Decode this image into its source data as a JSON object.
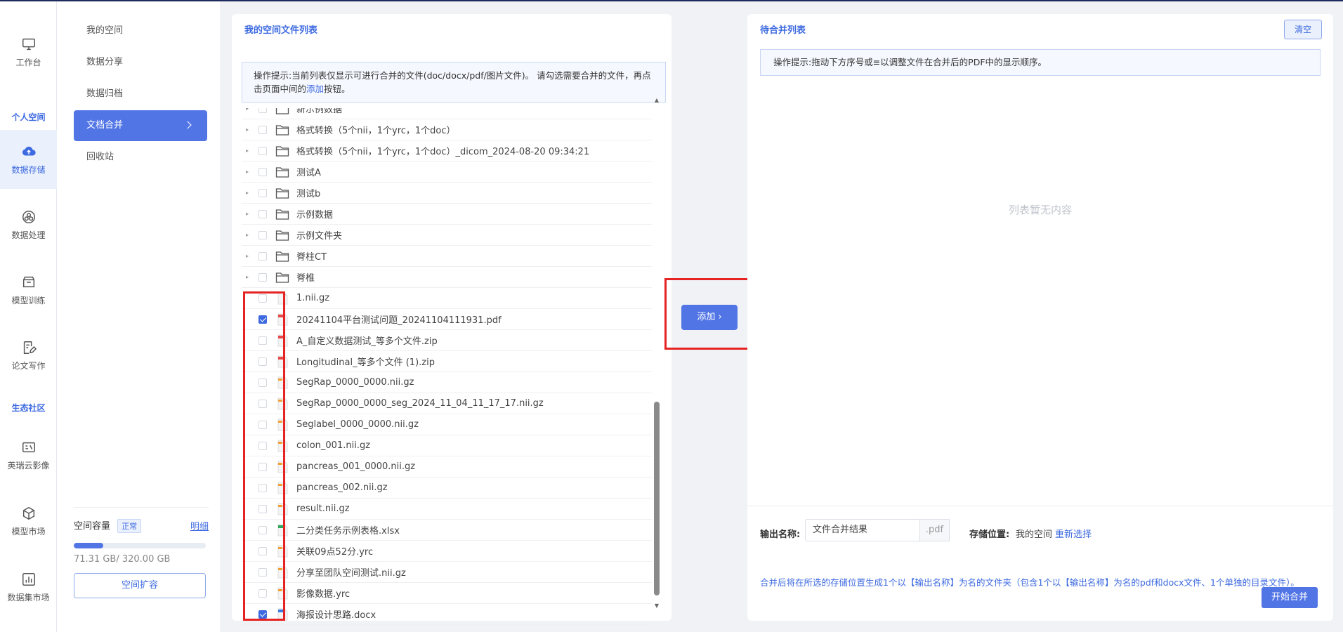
{
  "nav": {
    "items": [
      {
        "label": "工作台",
        "icon": "monitor-icon"
      },
      {
        "label": "数据存储",
        "icon": "cloud-upload-icon"
      },
      {
        "label": "数据处理",
        "icon": "process-icon"
      },
      {
        "label": "模型训练",
        "icon": "box-icon"
      },
      {
        "label": "论文写作",
        "icon": "edit-icon"
      },
      {
        "label": "英瑞云影像",
        "icon": "image-icon"
      },
      {
        "label": "模型市场",
        "icon": "cube-icon"
      },
      {
        "label": "数据集市场",
        "icon": "chart-icon"
      }
    ],
    "section_personal": "个人空间",
    "section_community": "生态社区"
  },
  "submenu": {
    "items": [
      "我的空间",
      "数据分享",
      "数据归档",
      "文档合并",
      "回收站"
    ],
    "active": "文档合并"
  },
  "storage": {
    "title": "空间容量",
    "status": "正常",
    "detail_link": "明细",
    "usage_text": "71.31 GB/ 320.00 GB",
    "used_fraction": 0.223,
    "expand_label": "空间扩容"
  },
  "file_panel": {
    "title": "我的空间文件列表",
    "hint_text": "操作提示:当前列表仅显示可进行合并的文件(doc/docx/pdf/图片文件)。 请勾选需要合并的文件，再点击页面中间的",
    "hint_link": "添加",
    "hint_suffix": "按钮。",
    "rows": [
      {
        "name": "新示例数据",
        "type": "folder",
        "checked": false
      },
      {
        "name": "格式转换（5个nii，1个yrc，1个doc）",
        "type": "folder",
        "checked": false
      },
      {
        "name": "格式转换（5个nii，1个yrc，1个doc）_dicom_2024-08-20 09:34:21",
        "type": "folder",
        "checked": false
      },
      {
        "name": "测试A",
        "type": "folder",
        "checked": false
      },
      {
        "name": "测试b",
        "type": "folder",
        "checked": false
      },
      {
        "name": "示例数据",
        "type": "folder",
        "checked": false
      },
      {
        "name": "示例文件夹",
        "type": "folder",
        "checked": false
      },
      {
        "name": "脊柱CT",
        "type": "folder",
        "checked": false
      },
      {
        "name": "脊椎",
        "type": "folder",
        "checked": false
      },
      {
        "name": "1.nii.gz",
        "type": "file-plain",
        "checked": false
      },
      {
        "name": "20241104平台测试问题_20241104111931.pdf",
        "type": "file-pdf",
        "checked": true
      },
      {
        "name": "A_自定义数据测试_等多个文件.zip",
        "type": "file-zip",
        "checked": false
      },
      {
        "name": "Longitudinal_等多个文件 (1).zip",
        "type": "file-zip",
        "checked": false
      },
      {
        "name": "SegRap_0000_0000.nii.gz",
        "type": "file-orange",
        "checked": false
      },
      {
        "name": "SegRap_0000_0000_seg_2024_11_04_11_17_17.nii.gz",
        "type": "file-orange",
        "checked": false
      },
      {
        "name": "Seglabel_0000_0000.nii.gz",
        "type": "file-orange",
        "checked": false
      },
      {
        "name": "colon_001.nii.gz",
        "type": "file-orange",
        "checked": false
      },
      {
        "name": "pancreas_001_0000.nii.gz",
        "type": "file-orange",
        "checked": false
      },
      {
        "name": "pancreas_002.nii.gz",
        "type": "file-orange",
        "checked": false
      },
      {
        "name": "result.nii.gz",
        "type": "file-orange",
        "checked": false
      },
      {
        "name": "二分类任务示例表格.xlsx",
        "type": "file-xlsx",
        "checked": false
      },
      {
        "name": "关联09点52分.yrc",
        "type": "file-orange",
        "checked": false
      },
      {
        "name": "分享至团队空间测试.nii.gz",
        "type": "file-orange",
        "checked": false
      },
      {
        "name": "影像数据.yrc",
        "type": "file-orange",
        "checked": false
      },
      {
        "name": "海报设计思路.docx",
        "type": "file-docx",
        "checked": true
      }
    ]
  },
  "add_button": "添加 ›",
  "merge_panel": {
    "title": "待合并列表",
    "clear_label": "清空",
    "hint_text": "操作提示:拖动下方序号或≡以调整文件在合并后的PDF中的显示顺序。",
    "empty_text": "列表暂无内容",
    "output_label": "输出名称:",
    "output_value": "文件合并结果",
    "output_suffix": ".pdf",
    "location_label": "存储位置:",
    "location_value": "我的空间",
    "reselect_link": "重新选择",
    "note": "合并后将在所选的存储位置生成1个以【输出名称】为名的文件夹（包含1个以【输出名称】为名的pdf和docx文件、1个单独的目录文件）。",
    "start_label": "开始合并"
  },
  "colors": {
    "accent": "#5275e6",
    "highlight_box": "#e62323"
  }
}
